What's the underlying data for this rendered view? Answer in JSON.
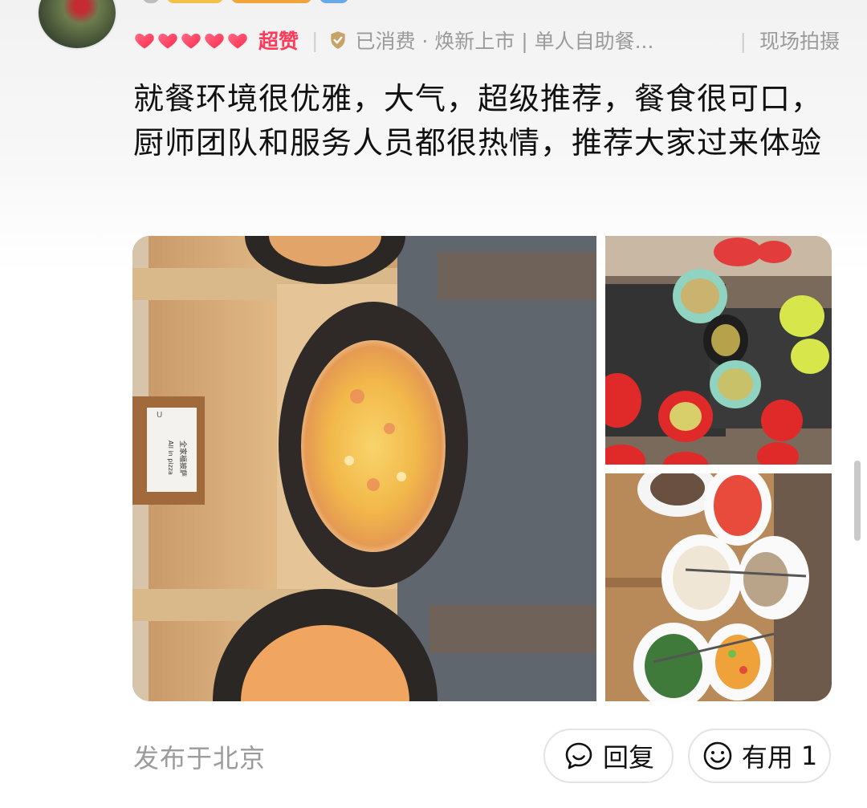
{
  "review": {
    "rating_label": "超赞",
    "hearts": 5,
    "consumed": "已消费 · 焕新上市 | 单人自助餐...",
    "photo_tag": "现场拍摄",
    "text": "就餐环境很优雅，大气，超级推荐，餐食很可口，厨师团队和服务人员都很热情，推荐大家过来体验",
    "photo_sign": {
      "brand": "U",
      "line1": "全家福披萨",
      "line2": "All in pizza"
    },
    "location": "发布于北京"
  },
  "actions": {
    "reply_label": "回复",
    "useful_label": "有用",
    "useful_count": "1"
  },
  "colors": {
    "accent_red": "#ff3b5c",
    "meta_gray": "#9b9b9b"
  },
  "icons": [
    "heart-icon",
    "verified-shield-icon",
    "comment-icon",
    "smile-icon"
  ]
}
